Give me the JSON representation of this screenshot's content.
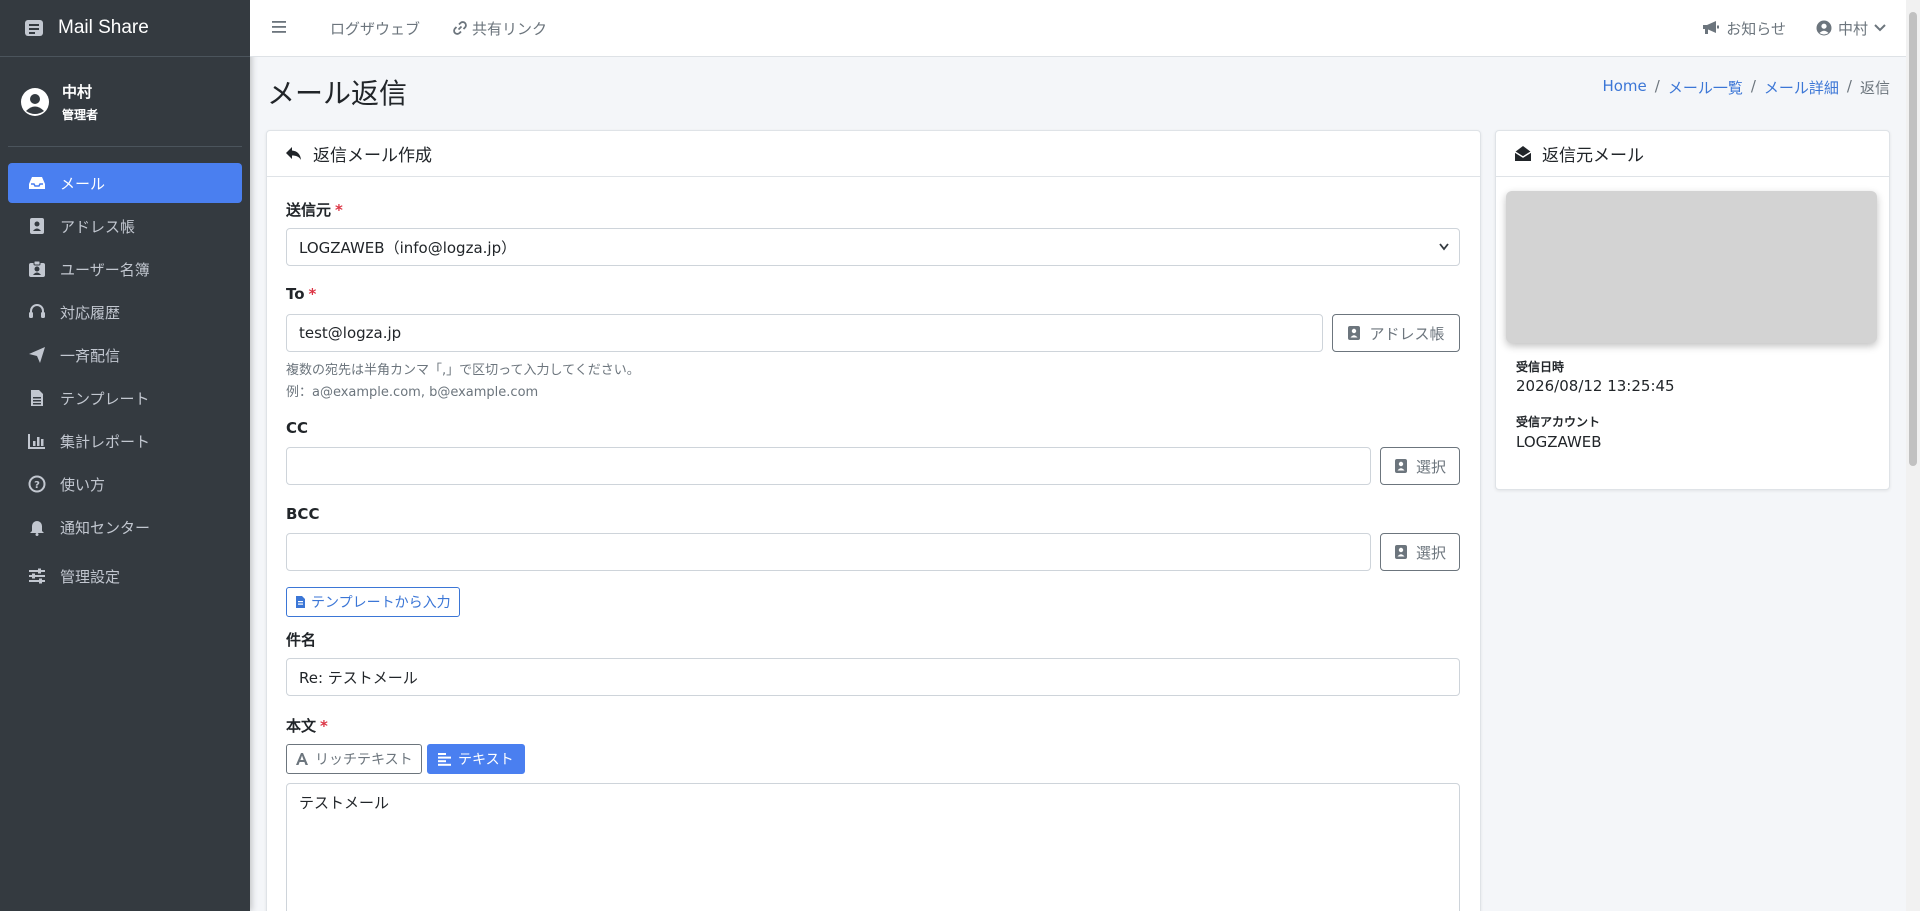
{
  "app": {
    "name": "Mail Share"
  },
  "user": {
    "name": "中村",
    "role": "管理者"
  },
  "sidebar": {
    "items": [
      {
        "label": "メール",
        "icon": "inbox-icon",
        "active": true
      },
      {
        "label": "アドレス帳",
        "icon": "address-book-icon"
      },
      {
        "label": "ユーザー名簿",
        "icon": "id-badge-icon"
      },
      {
        "label": "対応履歴",
        "icon": "headset-icon"
      },
      {
        "label": "一斉配信",
        "icon": "paper-plane-icon"
      },
      {
        "label": "テンプレート",
        "icon": "file-icon"
      },
      {
        "label": "集計レポート",
        "icon": "chart-bar-icon"
      },
      {
        "label": "使い方",
        "icon": "question-circle-icon"
      },
      {
        "label": "通知センター",
        "icon": "bell-icon"
      },
      {
        "label": "管理設定",
        "icon": "sliders-icon"
      }
    ]
  },
  "topbar": {
    "link1": "ログザウェブ",
    "link2": "共有リンク",
    "notice": "お知らせ",
    "user": "中村"
  },
  "page": {
    "title": "メール返信",
    "breadcrumb": [
      "Home",
      "メール一覧",
      "メール詳細",
      "返信"
    ]
  },
  "compose": {
    "header": "返信メール作成",
    "from_label": "送信元",
    "from_value": "LOGZAWEB（info@logza.jp）",
    "to_label": "To",
    "to_value": "test@logza.jp",
    "address_book_button": "アドレス帳",
    "to_help1": "複数の宛先は半角カンマ「,」で区切って入力してください。",
    "to_help2": "例：a@example.com, b@example.com",
    "cc_label": "CC",
    "cc_value": "",
    "cc_button": "選択",
    "bcc_label": "BCC",
    "bcc_value": "",
    "bcc_button": "選択",
    "template_button": "テンプレートから入力",
    "subject_label": "件名",
    "subject_value": "Re: テストメール",
    "body_label": "本文",
    "rich_text_button": "リッチテキスト",
    "text_button": "テキスト",
    "body_value": "テストメール"
  },
  "original": {
    "header": "返信元メール",
    "received_at_label": "受信日時",
    "received_at": "2026/08/12 13:25:45",
    "account_label": "受信アカウント",
    "account": "LOGZAWEB"
  },
  "colors": {
    "sidebar": "#343a40",
    "primary": "#4a7ff0",
    "link": "#3b76d6",
    "required": "#dc3545"
  }
}
